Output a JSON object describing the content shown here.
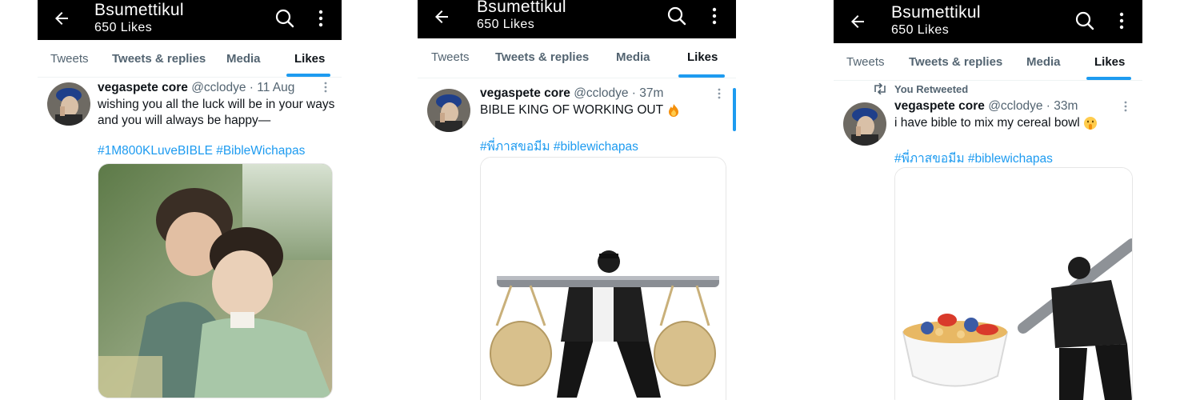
{
  "screens": [
    {
      "header": {
        "title": "Bsumettikul",
        "subtitle": "650 Likes"
      },
      "tabs": [
        "Tweets",
        "Tweets & replies",
        "Media",
        "Likes"
      ],
      "active_tab": "Likes",
      "tweet": {
        "display_name": "vegaspete core",
        "meta": "@cclodye · 11 Aug",
        "text_line1": "wishing you all the luck will be in your ways",
        "text_line2": "and you will always be happy—",
        "hashtag1": "#1M800KLuveBIBLE",
        "hashtag2": "#BibleWichapas",
        "media": "photo of two smiling men hugging outdoors"
      }
    },
    {
      "header": {
        "title": "Bsumettikul",
        "subtitle": "650 Likes"
      },
      "tabs": [
        "Tweets",
        "Tweets & replies",
        "Media",
        "Likes"
      ],
      "active_tab": "Likes",
      "tweet": {
        "display_name": "vegaspete core",
        "meta": "@cclodye · 37m",
        "text": "BIBLE KING OF WORKING OUT",
        "emoji": "fire-emoji",
        "hashtag1": "#พี่ภาสขอมีม",
        "hashtag2": "#biblewichapas",
        "media": "man carrying two wicker baskets on a pole"
      }
    },
    {
      "header": {
        "title": "Bsumettikul",
        "subtitle": "650 Likes"
      },
      "tabs": [
        "Tweets",
        "Tweets & replies",
        "Media",
        "Likes"
      ],
      "active_tab": "Likes",
      "retweet_label": "You Retweeted",
      "tweet": {
        "display_name": "vegaspete core",
        "meta": "@cclodye · 33m",
        "text": "i have bible to mix my cereal bowl",
        "emoji": "shushing-face-emoji",
        "hashtag1": "#พี่ภาสขอมีม",
        "hashtag2": "#biblewichapas",
        "media": "man stirring a giant cereal bowl with a pole"
      }
    }
  ],
  "colors": {
    "accent": "#1d9bf0",
    "header_bg": "#000000",
    "muted": "#536471"
  }
}
